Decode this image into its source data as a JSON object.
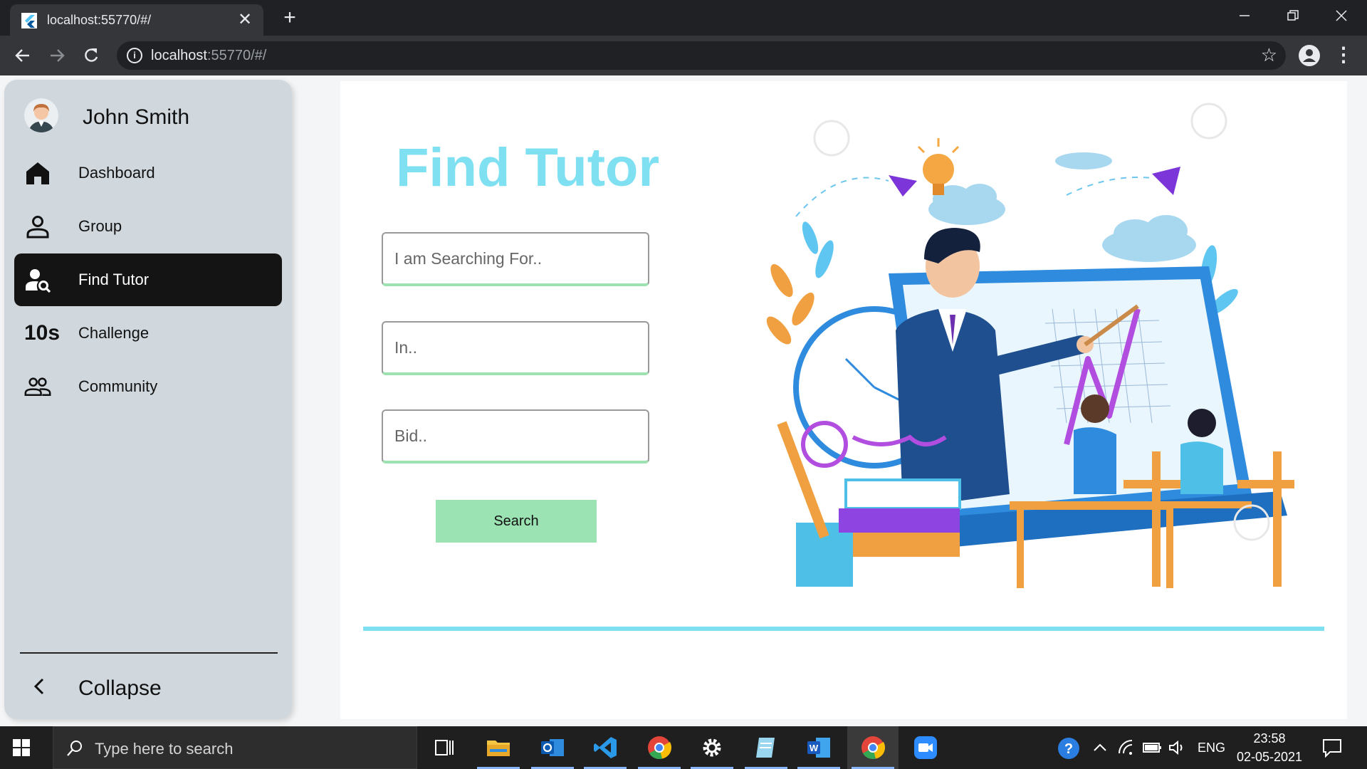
{
  "browser": {
    "tab_title": "localhost:55770/#/",
    "url_host": "localhost",
    "url_rest": ":55770/#/",
    "new_tab_symbol": "+",
    "close_symbol": "✕"
  },
  "sidebar": {
    "user_name": "John Smith",
    "items": [
      {
        "label": "Dashboard",
        "icon": "home-icon",
        "active": false
      },
      {
        "label": "Group",
        "icon": "person-icon",
        "active": false
      },
      {
        "label": "Find Tutor",
        "icon": "person-search-icon",
        "active": true
      },
      {
        "label": "Challenge",
        "icon": "timer-10s-icon",
        "icon_text": "10s",
        "active": false
      },
      {
        "label": "Community",
        "icon": "people-icon",
        "active": false
      }
    ],
    "collapse_label": "Collapse"
  },
  "main": {
    "title": "Find Tutor",
    "fields": [
      {
        "placeholder": "I am Searching For..",
        "value": ""
      },
      {
        "placeholder": "In..",
        "value": ""
      },
      {
        "placeholder": "Bid..",
        "value": ""
      }
    ],
    "search_label": "Search",
    "colors": {
      "title": "#7fe0f2",
      "button": "#9ce3b4",
      "field_underline": "#9ee2b2",
      "divider": "#7fe0f2",
      "active_nav": "#141414",
      "sidebar_bg": "#d0d8de"
    }
  },
  "taskbar": {
    "search_placeholder": "Type here to search",
    "apps": [
      "task-view-icon",
      "file-explorer-icon",
      "outlook-icon",
      "vscode-icon",
      "chrome-icon",
      "settings-icon",
      "notepad-icon",
      "word-icon",
      "chrome-icon",
      "zoom-icon"
    ],
    "language": "ENG",
    "time": "23:58",
    "date": "02-05-2021"
  }
}
